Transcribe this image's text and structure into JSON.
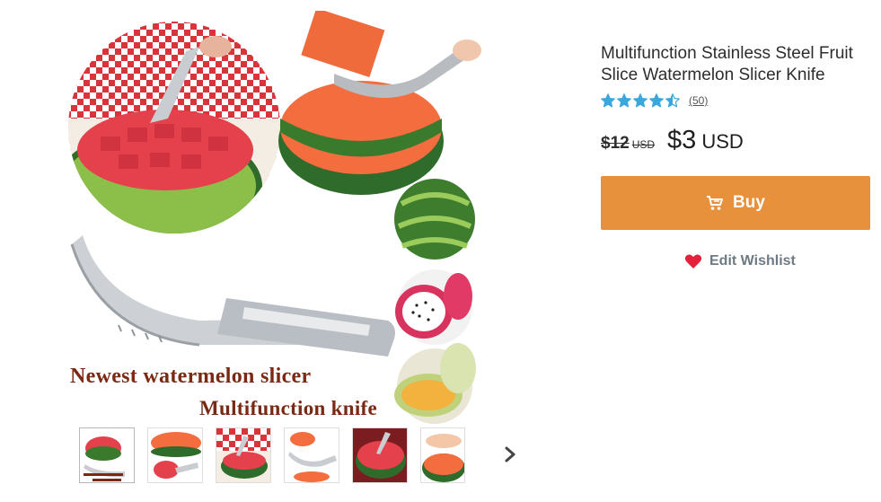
{
  "product": {
    "title": "Multifunction Stainless Steel Fruit Slice Watermelon Slicer Knife",
    "rating_count": "(50)",
    "old_price": "$12",
    "old_currency": "USD",
    "new_price": "$3",
    "new_currency": "USD"
  },
  "rating": {
    "value": 4.5,
    "max": 5,
    "star_color": "#3aa8dc"
  },
  "image": {
    "caption_line1": "Newest watermelon slicer",
    "caption_line2": "Multifunction knife"
  },
  "actions": {
    "buy_label": "Buy",
    "wishlist_label": "Edit Wishlist"
  },
  "icons": {
    "cart": "cart-icon",
    "heart": "heart-icon",
    "next": "chevron-right-icon",
    "star": "star-icon"
  },
  "colors": {
    "accent": "#e8913d",
    "heart": "#e3213b",
    "wishlist_text": "#6d7a84"
  },
  "thumbnails": {
    "count": 6,
    "active_index": 0
  }
}
